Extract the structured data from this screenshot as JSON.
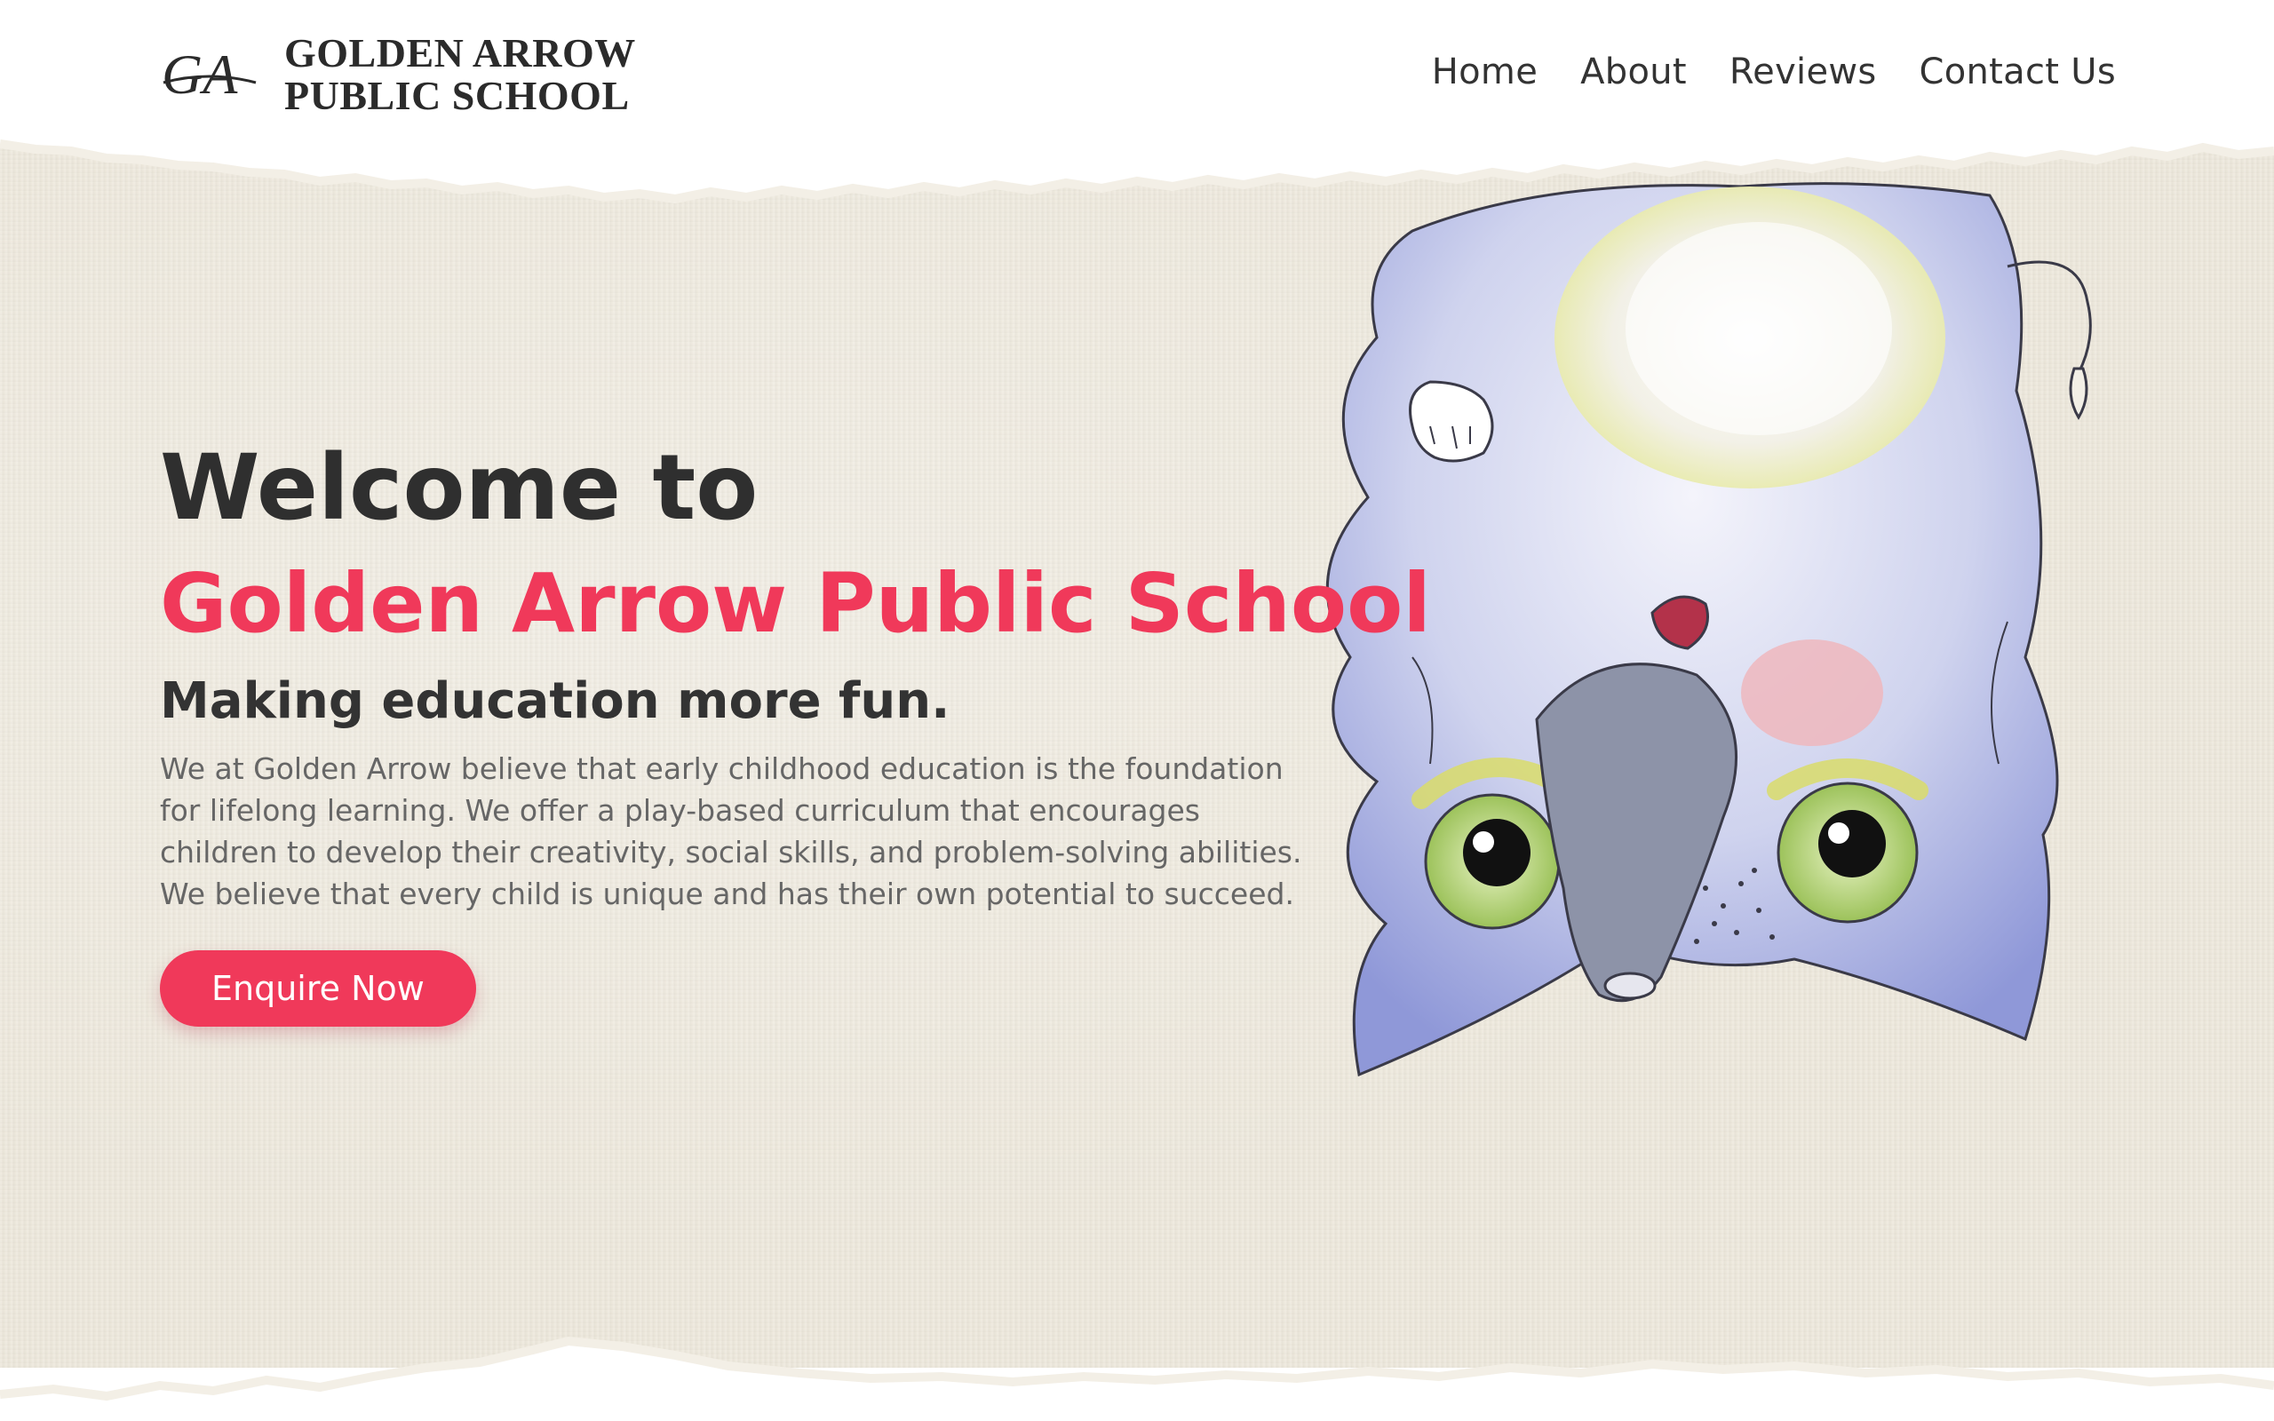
{
  "header": {
    "logo_mark": "GA",
    "logo_line1": "GOLDEN ARROW",
    "logo_line2": "PUBLIC SCHOOL",
    "nav": [
      {
        "label": "Home"
      },
      {
        "label": "About"
      },
      {
        "label": "Reviews"
      },
      {
        "label": "Contact Us"
      }
    ]
  },
  "hero": {
    "welcome": "Welcome to",
    "school_name": "Golden Arrow Public School",
    "tagline": "Making education more fun.",
    "intro": "We at Golden Arrow believe that early childhood education is the foundation for lifelong learning. We offer a play-based curriculum that encourages children to develop their creativity, social skills, and problem-solving abilities. We believe that every child is unique and has their own potential to succeed.",
    "cta_label": "Enquire Now"
  },
  "illustration": {
    "subject": "upside-down watercolor elephant icon"
  },
  "colors": {
    "accent": "#f0395a",
    "paper": "#ede8dc",
    "heading": "#2f2f2f",
    "body_text": "#666666"
  }
}
